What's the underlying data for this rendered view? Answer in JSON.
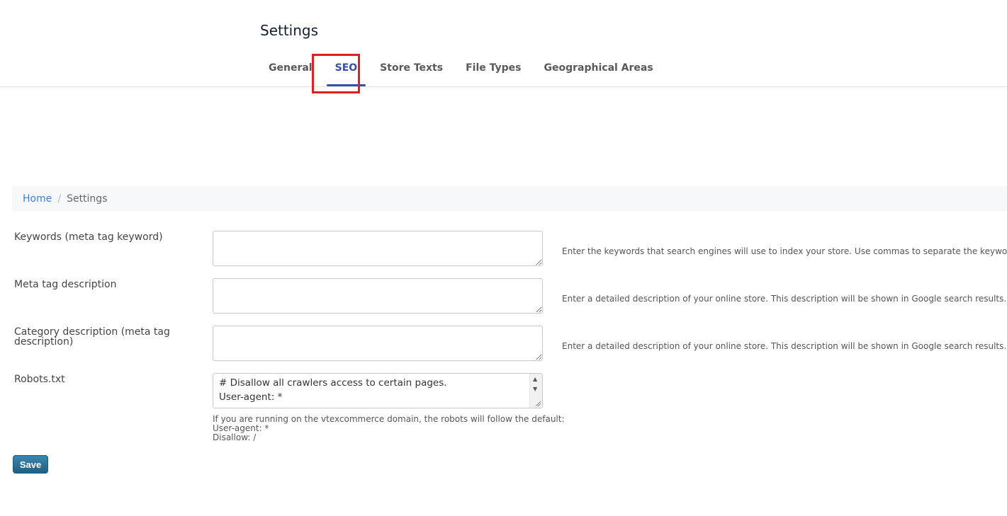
{
  "header": {
    "title": "Settings",
    "tabs": [
      {
        "label": "General",
        "active": false
      },
      {
        "label": "SEO",
        "active": true
      },
      {
        "label": "Store Texts",
        "active": false
      },
      {
        "label": "File Types",
        "active": false
      },
      {
        "label": "Geographical Areas",
        "active": false
      }
    ]
  },
  "breadcrumb": {
    "home": "Home",
    "separator": "/",
    "current": "Settings"
  },
  "form": {
    "keywords": {
      "label": "Keywords (meta tag keyword)",
      "value": "",
      "help": "Enter the keywords that search engines will use to index your store. Use commas to separate the keywords."
    },
    "meta_description": {
      "label": "Meta tag description",
      "value": "",
      "help": "Enter a detailed description of your online store. This description will be shown in Google search results."
    },
    "category_description": {
      "label": "Category description (meta tag description)",
      "value": "",
      "help": "Enter a detailed description of your online store. This description will be shown in Google search results."
    },
    "robots": {
      "label": "Robots.txt",
      "line1": "# Disallow all crawlers access to certain pages.",
      "line2": "User-agent: *",
      "note_line1": "If you are running on the vtexcommerce domain, the robots will follow the default:",
      "note_line2": "User-agent: *",
      "note_line3": "Disallow: /"
    },
    "save_label": "Save"
  },
  "colors": {
    "accent": "#3551a5",
    "highlight": "#e02020",
    "link": "#3c7fd1",
    "save_button": "#2a6f94"
  }
}
